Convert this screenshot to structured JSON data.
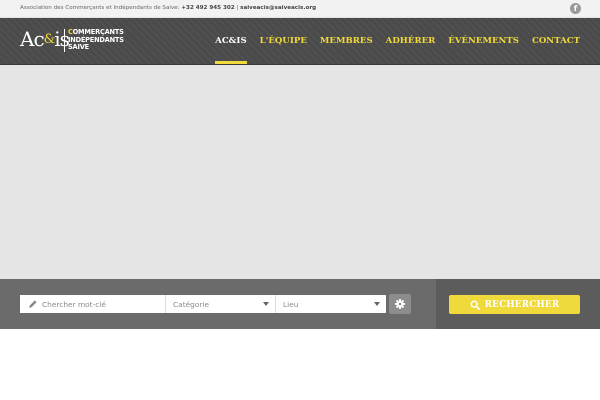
{
  "topbar": {
    "text_prefix": "Association des Commerçants et Indépendants de Saive:",
    "phone": "+32 492 945 302",
    "separator": "|",
    "email": "saiveacis@saiveacis.org",
    "social_icon": "facebook-icon"
  },
  "logo": {
    "mark_a": "Ac",
    "mark_amp": "&",
    "mark_is": "is",
    "line1_highlight": "C",
    "line1_rest": "OMMERÇANTS",
    "line2": "INDÉPENDANTS",
    "line3": "SAIVE"
  },
  "nav": {
    "items": [
      {
        "label": "AC&IS",
        "active": true
      },
      {
        "label": "L'ÉQUIPE",
        "active": false
      },
      {
        "label": "MEMBRES",
        "active": false
      },
      {
        "label": "ADHÉRER",
        "active": false
      },
      {
        "label": "ÉVÉNEMENTS",
        "active": false
      },
      {
        "label": "CONTACT",
        "active": false
      }
    ]
  },
  "search": {
    "keyword_placeholder": "Chercher mot-clé",
    "category_placeholder": "Catégorie",
    "location_placeholder": "Lieu",
    "button_label": "RECHERCHER",
    "icons": {
      "keyword": "pencil-icon",
      "settings": "gear-icon",
      "submit": "search-icon",
      "dropdown": "chevron-down-icon"
    }
  },
  "colors": {
    "accent": "#f0d93b",
    "header_bg": "#4a4a4a",
    "topbar_bg": "#f2f2f2",
    "map_bg": "#e5e5e5",
    "searchbar_bg": "#6b6b6b"
  }
}
